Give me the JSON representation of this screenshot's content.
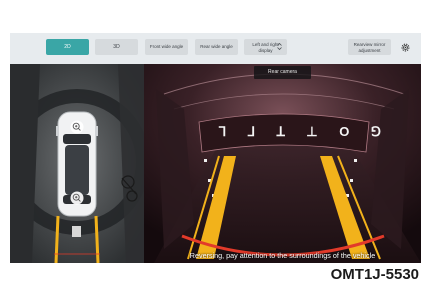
{
  "toolbar": {
    "view_2d": "2D",
    "view_3d": "3D",
    "front_wide": "Front wide angle",
    "rear_wide": "Rear wide angle",
    "left_right_line1": "Left and right",
    "left_right_line2": "display",
    "mirror_line1": "Rearview mirror",
    "mirror_line2": "adjustment",
    "settings_icon": "gear-icon",
    "toggle_icon": "updown-arrow-icon"
  },
  "camera": {
    "label": "Rear camera",
    "warning": "Reversing, pay attention to the surroundings of the vehicle",
    "tailgate_lettering": "ꓶ ⅃ ꓕ ⊥ O ⅁"
  },
  "birdseye": {
    "zoom_icon": "zoom-in-icon"
  },
  "figure_ref": "OMT1J-5530",
  "colors": {
    "accent": "#3aa6a6",
    "guide_yellow": "#f2b21b",
    "guide_red": "#e23a2a"
  }
}
